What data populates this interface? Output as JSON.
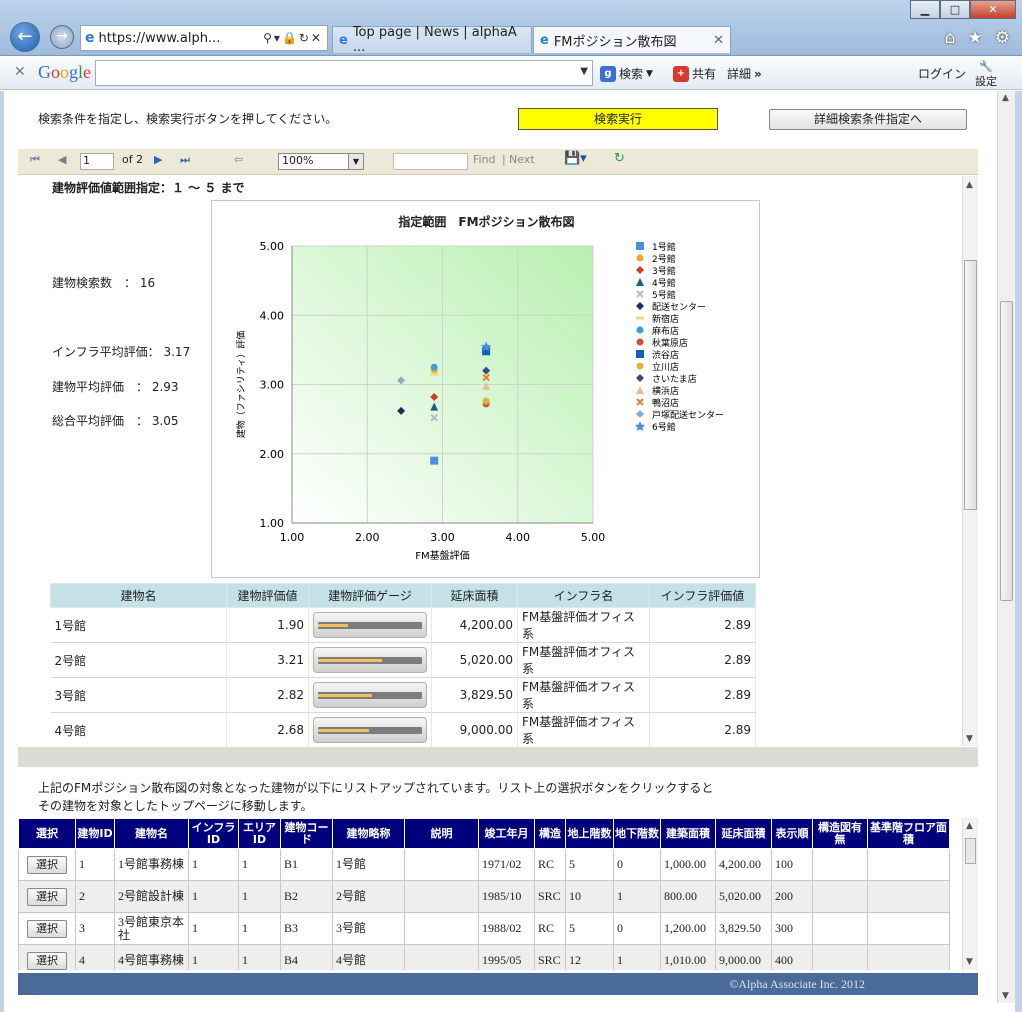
{
  "browser": {
    "address": "https://www.alph...",
    "tabs": [
      {
        "label": "Top page | News | alphaA ..."
      },
      {
        "label": "FMポジション散布図"
      }
    ],
    "google": {
      "label": "Google",
      "search": "検索",
      "share": "共有",
      "detail": "詳細",
      "login": "ログイン",
      "settings": "設定"
    }
  },
  "header": {
    "instruction": "検索条件を指定し、検索実行ボタンを押してください。",
    "run_button": "検索実行",
    "detail_button": "詳細検索条件指定へ"
  },
  "report_toolbar": {
    "page": "1",
    "of_pages": "of 2",
    "zoom": "100%",
    "find": "Find",
    "sep": "|",
    "next": "Next"
  },
  "report": {
    "range_label": "建物評価値範囲指定：１ ～ ５ まで",
    "stats": [
      {
        "label": "建物検索数　：",
        "value": "16"
      },
      {
        "label": "インフラ平均評価：",
        "value": "3.17"
      },
      {
        "label": "建物平均評価　：",
        "value": "2.93"
      },
      {
        "label": "総合平均評価　：",
        "value": "3.05"
      }
    ]
  },
  "chart_data": {
    "type": "scatter",
    "title": "指定範囲　FMポジション散布図",
    "xlabel": "FM基盤評価",
    "ylabel": "建物（ファシリティ）評価",
    "xlim": [
      1.0,
      5.0
    ],
    "ylim": [
      1.0,
      5.0
    ],
    "xticks": [
      "1.00",
      "2.00",
      "3.00",
      "4.00",
      "5.00"
    ],
    "yticks": [
      "1.00",
      "2.00",
      "3.00",
      "4.00",
      "5.00"
    ],
    "grid": true,
    "legend_position": "right",
    "series": [
      {
        "name": "1号館",
        "marker": "square",
        "color": "#4a8fe0",
        "x": 2.89,
        "y": 1.9
      },
      {
        "name": "2号館",
        "marker": "circle",
        "color": "#f0a830",
        "x": 2.89,
        "y": 3.21
      },
      {
        "name": "3号館",
        "marker": "diamond",
        "color": "#d04020",
        "x": 2.89,
        "y": 2.82
      },
      {
        "name": "4号館",
        "marker": "triangle",
        "color": "#1e5a8a",
        "x": 2.89,
        "y": 2.68
      },
      {
        "name": "5号館",
        "marker": "cross",
        "color": "#b8b8c8",
        "x": 2.89,
        "y": 2.52
      },
      {
        "name": "配送センター",
        "marker": "diamond",
        "color": "#1e2a5a",
        "x": 2.45,
        "y": 2.62
      },
      {
        "name": "新宿店",
        "marker": "dash",
        "color": "#f0d890",
        "x": 2.89,
        "y": 3.15
      },
      {
        "name": "麻布店",
        "marker": "circle",
        "color": "#3aa0d0",
        "x": 2.89,
        "y": 3.25
      },
      {
        "name": "秋葉原店",
        "marker": "circle",
        "color": "#d05030",
        "x": 3.58,
        "y": 2.72
      },
      {
        "name": "渋谷店",
        "marker": "square",
        "color": "#1060c0",
        "x": 3.58,
        "y": 3.48
      },
      {
        "name": "立川店",
        "marker": "circle",
        "color": "#e0b040",
        "x": 3.58,
        "y": 2.76
      },
      {
        "name": "さいたま店",
        "marker": "diamond",
        "color": "#3a4a7a",
        "x": 3.58,
        "y": 3.2
      },
      {
        "name": "横浜店",
        "marker": "triangle",
        "color": "#f0b8a0",
        "x": 3.58,
        "y": 2.98
      },
      {
        "name": "鴨沼店",
        "marker": "cross",
        "color": "#e08030",
        "x": 3.58,
        "y": 3.1
      },
      {
        "name": "戸塚配送センター",
        "marker": "diamond",
        "color": "#90a8d0",
        "x": 2.45,
        "y": 3.06
      },
      {
        "name": "6号館",
        "marker": "star",
        "color": "#4a8fe0",
        "x": 3.58,
        "y": 3.55
      }
    ]
  },
  "building_table": {
    "columns": [
      "建物名",
      "建物評価値",
      "建物評価ゲージ",
      "延床面積",
      "インフラ名",
      "インフラ評価値"
    ],
    "rows": [
      {
        "name": "1号館",
        "score": "1.90",
        "gauge": 0.29,
        "area": "4,200.00",
        "infra": "FM基盤評価オフィス系",
        "infra_score": "2.89"
      },
      {
        "name": "2号館",
        "score": "3.21",
        "gauge": 0.62,
        "area": "5,020.00",
        "infra": "FM基盤評価オフィス系",
        "infra_score": "2.89"
      },
      {
        "name": "3号館",
        "score": "2.82",
        "gauge": 0.52,
        "area": "3,829.50",
        "infra": "FM基盤評価オフィス系",
        "infra_score": "2.89"
      },
      {
        "name": "4号館",
        "score": "2.68",
        "gauge": 0.49,
        "area": "9,000.00",
        "infra": "FM基盤評価オフィス系",
        "infra_score": "2.89"
      }
    ]
  },
  "notes": [
    "上記のFMポジション散布図の対象となった建物が以下にリストアップされています。リスト上の選択ボタンをクリックすると",
    "その建物を対象としたトップページに移動します。"
  ],
  "list_table": {
    "columns": [
      "選択",
      "建物ID",
      "建物名",
      "インフラID",
      "エリアID",
      "建物コード",
      "建物略称",
      "説明",
      "竣工年月",
      "構造",
      "地上階数",
      "地下階数",
      "建築面積",
      "延床面積",
      "表示順",
      "構造図有無",
      "基準階フロア面積"
    ],
    "select_label": "選択",
    "rows": [
      [
        "1",
        "1号館事務棟",
        "1",
        "1",
        "B1",
        "1号館",
        "",
        "1971/02",
        "RC",
        "5",
        "0",
        "1,000.00",
        "4,200.00",
        "100",
        "",
        ""
      ],
      [
        "2",
        "2号館設計棟",
        "1",
        "1",
        "B2",
        "2号館",
        "",
        "1985/10",
        "SRC",
        "10",
        "1",
        "800.00",
        "5,020.00",
        "200",
        "",
        ""
      ],
      [
        "3",
        "3号館東京本社",
        "1",
        "1",
        "B3",
        "3号館",
        "",
        "1988/02",
        "RC",
        "5",
        "0",
        "1,200.00",
        "3,829.50",
        "300",
        "",
        ""
      ],
      [
        "4",
        "4号館事務棟",
        "1",
        "1",
        "B4",
        "4号館",
        "",
        "1995/05",
        "SRC",
        "12",
        "1",
        "1,010.00",
        "9,000.00",
        "400",
        "",
        ""
      ]
    ]
  },
  "footer": {
    "copyright": "©Alpha Associate Inc. 2012"
  }
}
